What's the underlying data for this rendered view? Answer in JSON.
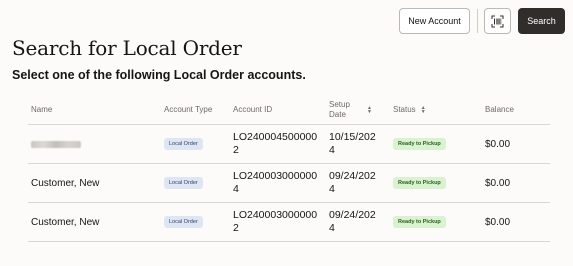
{
  "toolbar": {
    "new_account_label": "New Account",
    "scan_icon": "barcode-scan-icon",
    "search_label": "Search"
  },
  "page": {
    "title": "Search for Local Order",
    "subtitle": "Select one of the following Local Order accounts."
  },
  "table": {
    "columns": {
      "name": "Name",
      "account_type": "Account Type",
      "account_id": "Account ID",
      "setup_date": "Setup Date",
      "status": "Status",
      "balance": "Balance"
    },
    "rows": [
      {
        "name": "",
        "name_redacted": true,
        "account_type": "Local Order",
        "account_id": "LO2400045000002",
        "setup_date": "10/15/2024",
        "status": "Ready to Pickup",
        "balance": "$0.00"
      },
      {
        "name": "Customer, New",
        "account_type": "Local Order",
        "account_id": "LO2400030000004",
        "setup_date": "09/24/2024",
        "status": "Ready to Pickup",
        "balance": "$0.00"
      },
      {
        "name": "Customer, New",
        "account_type": "Local Order",
        "account_id": "LO2400030000002",
        "setup_date": "09/24/2024",
        "status": "Ready to Pickup",
        "balance": "$0.00"
      }
    ]
  }
}
